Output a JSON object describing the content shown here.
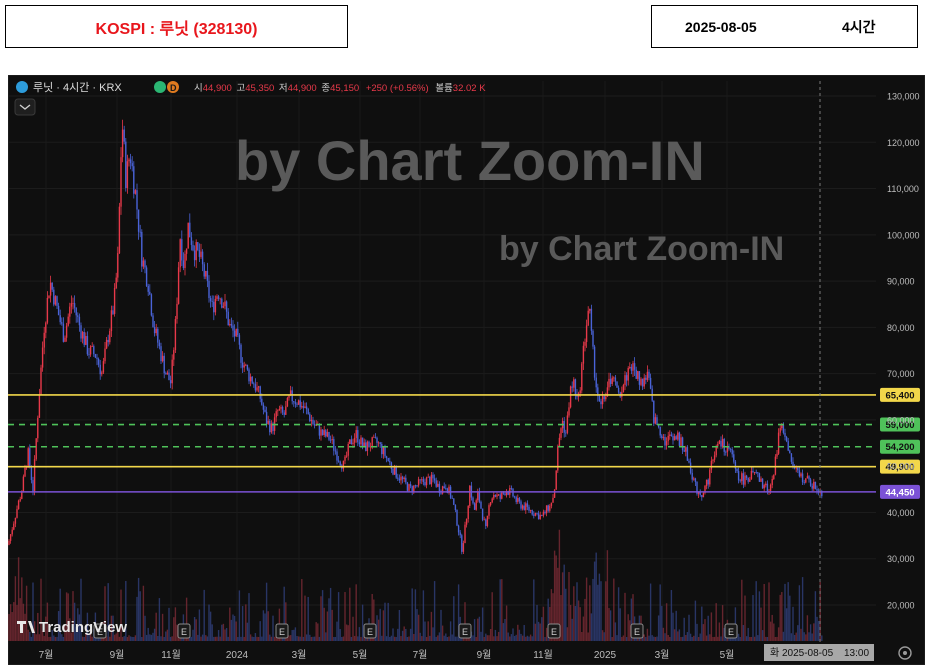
{
  "header": {
    "title": "KOSPI : 루닛 (328130)",
    "date": "2025-08-05",
    "interval": "4시간"
  },
  "legend": {
    "symbol": "루닛 · 4시간 · KRX",
    "badge": "D",
    "open_label": "시",
    "open": "44,900",
    "high_label": "고",
    "high": "45,350",
    "low_label": "저",
    "low": "44,900",
    "close_label": "종",
    "close": "45,150",
    "change": "+250 (+0.56%)",
    "volume_label": "볼륨",
    "volume": "32.02 K"
  },
  "watermarks": [
    "by Chart Zoom-IN",
    "by Chart Zoom-IN"
  ],
  "branding": "TradingView",
  "crosshair": {
    "date": "화 2025-08-05",
    "time": "13:00"
  },
  "earnings_marker": "E",
  "colors": {
    "up": "#e8394a",
    "down": "#4a63d8",
    "solid_level": "#f2d74a",
    "dashed_level": "#4fc25a",
    "current_price": "#7b52d6",
    "background": "#0f0f0f"
  },
  "chart_data": {
    "type": "candlestick",
    "symbol": "루닛",
    "exchange": "KRX",
    "interval": "4시간",
    "y_axis": {
      "min": 13000,
      "max": 132000,
      "ticks": [
        20000,
        30000,
        40000,
        50000,
        60000,
        70000,
        80000,
        90000,
        100000,
        110000,
        120000,
        130000
      ]
    },
    "x_axis_labels": [
      "7월",
      "9월",
      "11월",
      "2024",
      "3월",
      "5월",
      "7월",
      "9월",
      "11월",
      "2025",
      "3월",
      "5월"
    ],
    "earnings_events": 8,
    "levels": [
      {
        "value": 65400,
        "label": "65,400",
        "style": "solid"
      },
      {
        "value": 59000,
        "label": "59,000",
        "style": "dashed"
      },
      {
        "value": 54200,
        "label": "54,200",
        "style": "dashed"
      },
      {
        "value": 49900,
        "label": "49,900",
        "style": "solid"
      },
      {
        "value": 44450,
        "label": "44,450",
        "style": "current"
      }
    ],
    "price_path": [
      [
        0,
        33000
      ],
      [
        8,
        40000
      ],
      [
        14,
        45000
      ],
      [
        20,
        53000
      ],
      [
        25,
        45000
      ],
      [
        30,
        62000
      ],
      [
        36,
        80000
      ],
      [
        42,
        90000
      ],
      [
        48,
        85000
      ],
      [
        56,
        78000
      ],
      [
        64,
        86000
      ],
      [
        72,
        80000
      ],
      [
        80,
        75000
      ],
      [
        88,
        74000
      ],
      [
        94,
        70000
      ],
      [
        100,
        78000
      ],
      [
        106,
        85000
      ],
      [
        110,
        95000
      ],
      [
        114,
        125000
      ],
      [
        118,
        112000
      ],
      [
        122,
        118000
      ],
      [
        128,
        108000
      ],
      [
        134,
        95000
      ],
      [
        140,
        90000
      ],
      [
        146,
        80000
      ],
      [
        152,
        75000
      ],
      [
        158,
        70000
      ],
      [
        163,
        68000
      ],
      [
        168,
        82000
      ],
      [
        172,
        100000
      ],
      [
        176,
        93000
      ],
      [
        180,
        102000
      ],
      [
        186,
        97000
      ],
      [
        192,
        95000
      ],
      [
        198,
        90000
      ],
      [
        204,
        84000
      ],
      [
        210,
        88000
      ],
      [
        216,
        85000
      ],
      [
        222,
        80000
      ],
      [
        228,
        78000
      ],
      [
        234,
        73000
      ],
      [
        240,
        70000
      ],
      [
        246,
        68000
      ],
      [
        252,
        65000
      ],
      [
        258,
        60000
      ],
      [
        264,
        58000
      ],
      [
        270,
        62000
      ],
      [
        276,
        61000
      ],
      [
        282,
        65000
      ],
      [
        290,
        64000
      ],
      [
        298,
        62000
      ],
      [
        306,
        59000
      ],
      [
        314,
        57000
      ],
      [
        322,
        56000
      ],
      [
        330,
        52000
      ],
      [
        336,
        50000
      ],
      [
        342,
        55000
      ],
      [
        348,
        57000
      ],
      [
        356,
        54000
      ],
      [
        364,
        55000
      ],
      [
        370,
        55000
      ],
      [
        378,
        52000
      ],
      [
        386,
        49000
      ],
      [
        394,
        47000
      ],
      [
        402,
        45000
      ],
      [
        410,
        46000
      ],
      [
        418,
        47000
      ],
      [
        426,
        47000
      ],
      [
        432,
        45000
      ],
      [
        438,
        46000
      ],
      [
        444,
        43000
      ],
      [
        450,
        37000
      ],
      [
        454,
        32000
      ],
      [
        458,
        38000
      ],
      [
        462,
        46000
      ],
      [
        466,
        40000
      ],
      [
        470,
        44000
      ],
      [
        474,
        40000
      ],
      [
        478,
        36000
      ],
      [
        482,
        43000
      ],
      [
        486,
        44000
      ],
      [
        492,
        43000
      ],
      [
        498,
        45000
      ],
      [
        504,
        44000
      ],
      [
        510,
        42000
      ],
      [
        518,
        41000
      ],
      [
        526,
        40000
      ],
      [
        534,
        39000
      ],
      [
        540,
        41000
      ],
      [
        546,
        44000
      ],
      [
        550,
        54000
      ],
      [
        554,
        60000
      ],
      [
        558,
        57000
      ],
      [
        562,
        66000
      ],
      [
        566,
        68000
      ],
      [
        570,
        63000
      ],
      [
        574,
        72000
      ],
      [
        578,
        80000
      ],
      [
        581,
        85000
      ],
      [
        584,
        76000
      ],
      [
        588,
        68000
      ],
      [
        592,
        62000
      ],
      [
        598,
        66000
      ],
      [
        604,
        70000
      ],
      [
        610,
        65000
      ],
      [
        616,
        68000
      ],
      [
        622,
        72000
      ],
      [
        628,
        70000
      ],
      [
        634,
        68000
      ],
      [
        640,
        70000
      ],
      [
        646,
        60000
      ],
      [
        652,
        58000
      ],
      [
        658,
        55000
      ],
      [
        664,
        57000
      ],
      [
        670,
        56000
      ],
      [
        676,
        54000
      ],
      [
        682,
        50000
      ],
      [
        688,
        45000
      ],
      [
        694,
        44000
      ],
      [
        700,
        47000
      ],
      [
        706,
        53000
      ],
      [
        712,
        55000
      ],
      [
        718,
        54000
      ],
      [
        724,
        52000
      ],
      [
        730,
        48000
      ],
      [
        736,
        47000
      ],
      [
        742,
        48000
      ],
      [
        748,
        48000
      ],
      [
        754,
        46000
      ],
      [
        760,
        45000
      ],
      [
        766,
        48000
      ],
      [
        770,
        56000
      ],
      [
        774,
        60000
      ],
      [
        778,
        55000
      ],
      [
        782,
        52000
      ],
      [
        786,
        49000
      ],
      [
        792,
        48000
      ],
      [
        798,
        47000
      ],
      [
        804,
        46000
      ],
      [
        810,
        45000
      ],
      [
        814,
        44450
      ]
    ]
  }
}
